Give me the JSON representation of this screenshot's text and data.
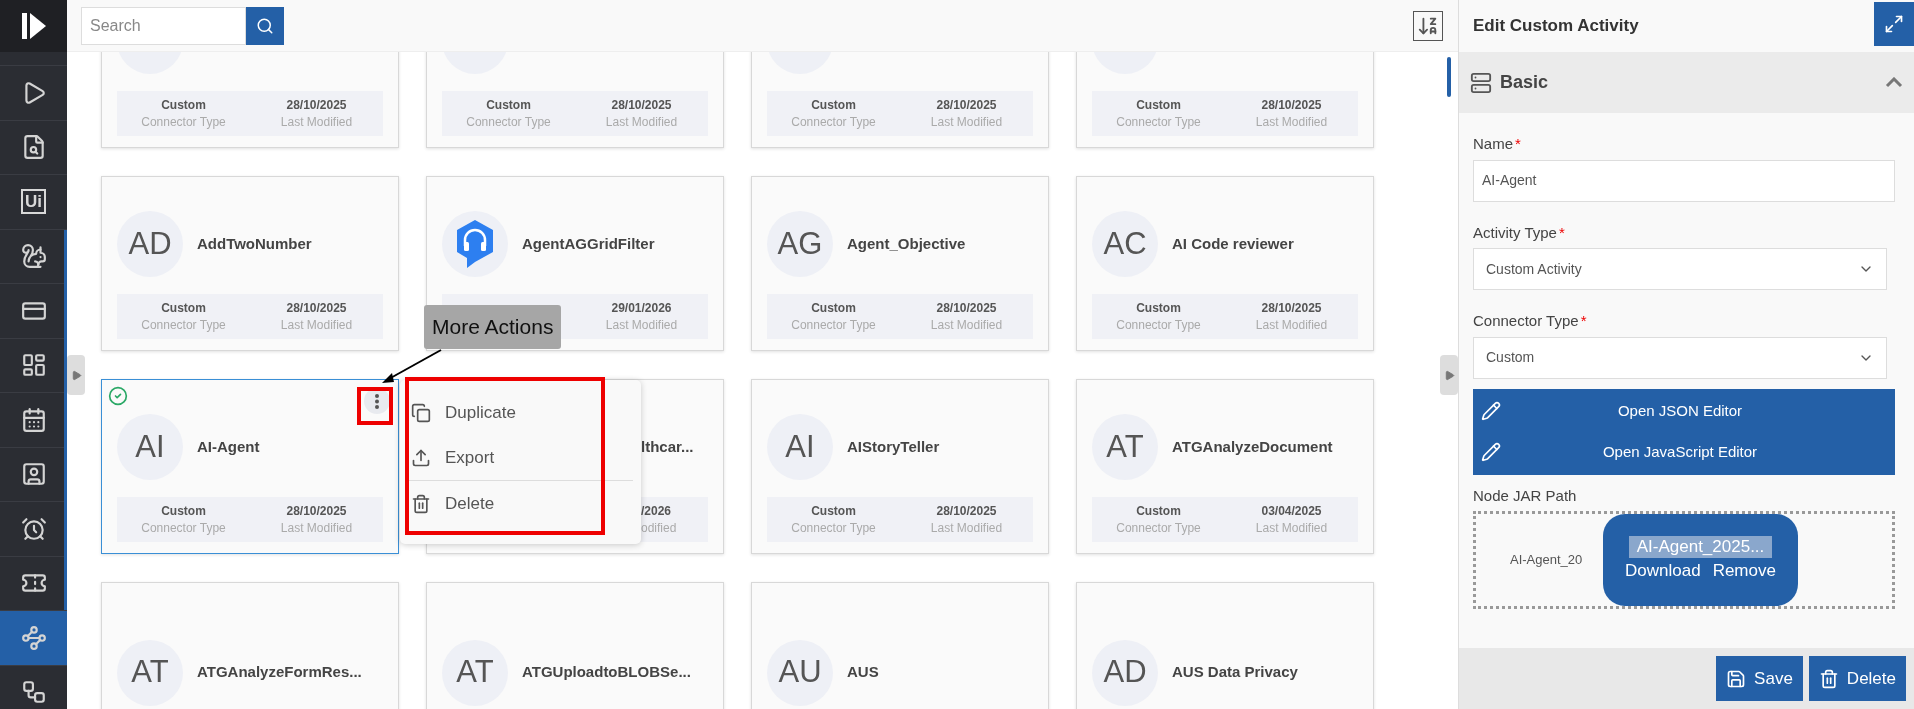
{
  "sidebar": {
    "items": [
      {
        "kind": "icon",
        "selected": false
      },
      {
        "kind": "icon",
        "selected": false
      },
      {
        "kind": "text",
        "label": "Ui",
        "selected": false
      },
      {
        "kind": "icon",
        "selected": false
      },
      {
        "kind": "icon",
        "selected": false
      },
      {
        "kind": "icon",
        "selected": false
      },
      {
        "kind": "icon",
        "selected": false
      },
      {
        "kind": "icon",
        "selected": false
      },
      {
        "kind": "icon",
        "selected": false
      },
      {
        "kind": "icon",
        "selected": false
      },
      {
        "kind": "icon",
        "selected": true
      },
      {
        "kind": "icon",
        "selected": false
      }
    ]
  },
  "search": {
    "placeholder": "Search"
  },
  "cards": [
    {
      "kind": "avatar",
      "connector_type": "Custom",
      "connector_label": "Connector Type",
      "date": "28/10/2025",
      "date_label": "Last Modified",
      "selected": false
    },
    {
      "kind": "avatar",
      "connector_type": "Custom",
      "connector_label": "Connector Type",
      "date": "28/10/2025",
      "date_label": "Last Modified",
      "selected": false
    },
    {
      "kind": "avatar",
      "connector_type": "Custom",
      "connector_label": "Connector Type",
      "date": "28/10/2025",
      "date_label": "Last Modified",
      "selected": false
    },
    {
      "kind": "avatar",
      "connector_type": "Custom",
      "connector_label": "Connector Type",
      "date": "28/10/2025",
      "date_label": "Last Modified",
      "selected": false
    },
    {
      "kind": "avatar",
      "initials": "AD",
      "name": "AddTwoNumber",
      "connector_type": "Custom",
      "connector_label": "Connector Type",
      "date": "28/10/2025",
      "date_label": "Last Modified",
      "selected": false
    },
    {
      "kind": "logo",
      "name": "AgentAGGridFilter",
      "date": "29/01/2026",
      "date_label": "Last Modified",
      "selected": false
    },
    {
      "kind": "avatar",
      "initials": "AG",
      "name": "Agent_Objective",
      "connector_type": "Custom",
      "connector_label": "Connector Type",
      "date": "28/10/2025",
      "date_label": "Last Modified",
      "selected": false
    },
    {
      "kind": "avatar",
      "initials": "AC",
      "name": "AI Code reviewer",
      "connector_type": "Custom",
      "connector_label": "Connector Type",
      "date": "28/10/2025",
      "date_label": "Last Modified",
      "selected": false
    },
    {
      "kind": "avatar",
      "initials": "AI",
      "name": "AI-Agent",
      "connector_type": "Custom",
      "connector_label": "Connector Type",
      "date": "28/10/2025",
      "date_label": "Last Modified",
      "selected": true
    },
    {
      "kind": "covered",
      "name": "lthcar...",
      "date": "/2026",
      "date_label": "odified",
      "selected": false
    },
    {
      "kind": "avatar",
      "initials": "AI",
      "name": "AIStoryTeller",
      "connector_type": "Custom",
      "connector_label": "Connector Type",
      "date": "28/10/2025",
      "date_label": "Last Modified",
      "selected": false
    },
    {
      "kind": "avatar",
      "initials": "AT",
      "name": "ATGAnalyzeDocument",
      "connector_type": "Custom",
      "connector_label": "Connector Type",
      "date": "03/04/2025",
      "date_label": "Last Modified",
      "selected": false
    },
    {
      "kind": "avatar",
      "initials": "AT",
      "name": "ATGAnalyzeFormRes...",
      "selected": false
    },
    {
      "kind": "avatar",
      "initials": "AT",
      "name": "ATGUploadtoBLOBSe...",
      "selected": false
    },
    {
      "kind": "avatar",
      "initials": "AU",
      "name": "AUS",
      "selected": false
    },
    {
      "kind": "avatar",
      "initials": "AD",
      "name": "AUS Data Privacy",
      "selected": false
    }
  ],
  "tooltip": {
    "text": "More Actions"
  },
  "context_menu": {
    "items": [
      {
        "label": "Duplicate",
        "separated": false
      },
      {
        "label": "Export",
        "separated": false
      },
      {
        "label": "Delete",
        "separated": true
      }
    ]
  },
  "panel": {
    "title": "Edit Custom Activity",
    "section": {
      "title": "Basic",
      "expanded": true
    },
    "name_field": {
      "label": "Name",
      "required_mark": "*",
      "value": "AI-Agent"
    },
    "activity_type": {
      "label": "Activity Type",
      "required_mark": "*",
      "value": "Custom Activity"
    },
    "connector_type": {
      "label": "Connector Type",
      "required_mark": "*",
      "value": "Custom"
    },
    "editor_buttons": [
      "Open JSON Editor",
      "Open JavaScript Editor"
    ],
    "jar_path": {
      "label": "Node JAR Path",
      "file_name": "AI-Agent_20",
      "popup_file": "AI-Agent_2025...",
      "actions": [
        "Download",
        "Remove"
      ]
    },
    "footer_buttons": [
      "Save",
      "Delete"
    ]
  }
}
